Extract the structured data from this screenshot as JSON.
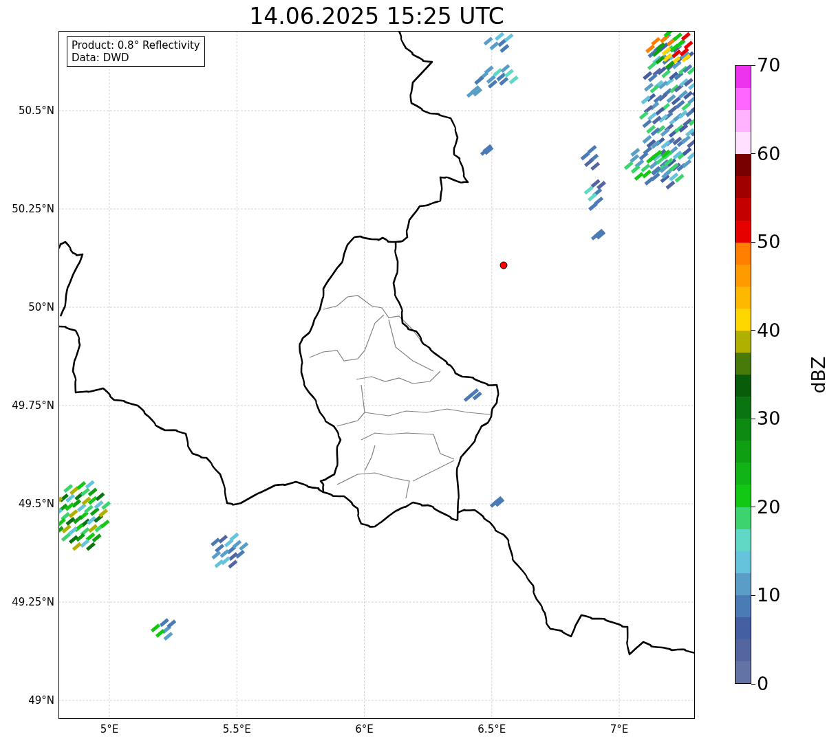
{
  "title": "14.06.2025 15:25 UTC",
  "legend": {
    "lines": [
      "Product: 0.8° Reflectivity",
      "Data: DWD"
    ]
  },
  "map": {
    "lat_ticks": [
      "50.5°N",
      "50.25°N",
      "50°N",
      "49.75°N",
      "49.5°N",
      "49.25°N",
      "49°N"
    ],
    "lon_ticks": [
      "5°E",
      "5.5°E",
      "6°E",
      "6.5°E",
      "7°E"
    ]
  },
  "colorbar": {
    "label": "dBZ",
    "ticks": [
      "70",
      "60",
      "50",
      "40",
      "30",
      "20",
      "10",
      "0"
    ],
    "bins": [
      {
        "color": "#ee33ee"
      },
      {
        "color": "#ff66ff"
      },
      {
        "color": "#ffb3ff"
      },
      {
        "color": "#ffe0ff"
      },
      {
        "color": "#780000"
      },
      {
        "color": "#a00000"
      },
      {
        "color": "#c40000"
      },
      {
        "color": "#e60000"
      },
      {
        "color": "#ff7f00"
      },
      {
        "color": "#ff9a00"
      },
      {
        "color": "#ffb800"
      },
      {
        "color": "#ffd700"
      },
      {
        "color": "#b0b000"
      },
      {
        "color": "#487a0a"
      },
      {
        "color": "#085c0a"
      },
      {
        "color": "#0a7410"
      },
      {
        "color": "#0d8a12"
      },
      {
        "color": "#0f9f12"
      },
      {
        "color": "#10b416"
      },
      {
        "color": "#12c812"
      },
      {
        "color": "#3cd46e"
      },
      {
        "color": "#5fd8c6"
      },
      {
        "color": "#66c3dc"
      },
      {
        "color": "#5a9ec8"
      },
      {
        "color": "#4b7bb5"
      },
      {
        "color": "#4560a2"
      },
      {
        "color": "#5466a0"
      },
      {
        "color": "#6473a6"
      }
    ]
  }
}
